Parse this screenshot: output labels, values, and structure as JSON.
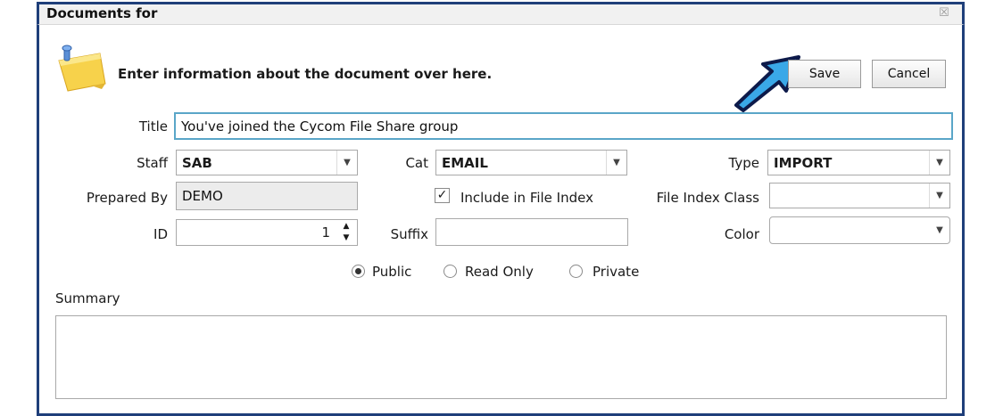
{
  "window": {
    "title": "Documents for",
    "close_glyph": "☒"
  },
  "header": {
    "text": "Enter information about the document over here.",
    "icon": "sticky-note-pin-icon"
  },
  "buttons": {
    "save": "Save",
    "cancel": "Cancel"
  },
  "form": {
    "title_label": "Title",
    "title_value": "You've joined the Cycom File Share group",
    "staff_label": "Staff",
    "staff_value": "SAB",
    "cat_label": "Cat",
    "cat_value": "EMAIL",
    "type_label": "Type",
    "type_value": "IMPORT",
    "prepared_by_label": "Prepared By",
    "prepared_by_value": "DEMO",
    "include_label": "Include in File Index",
    "include_checked": true,
    "file_index_class_label": "File Index Class",
    "file_index_class_value": "",
    "id_label": "ID",
    "id_value": "1",
    "suffix_label": "Suffix",
    "suffix_value": "",
    "color_label": "Color",
    "color_value": "",
    "visibility": {
      "public": "Public",
      "read_only": "Read Only",
      "private": "Private",
      "selected": "Public"
    },
    "summary_label": "Summary",
    "summary_value": ""
  },
  "annotation": {
    "arrow_color": "#3aa8e8",
    "arrow_outline": "#0d1a4a"
  },
  "theme": {
    "frame": "#1f3f7a",
    "focus_border": "#5aa6c8"
  }
}
